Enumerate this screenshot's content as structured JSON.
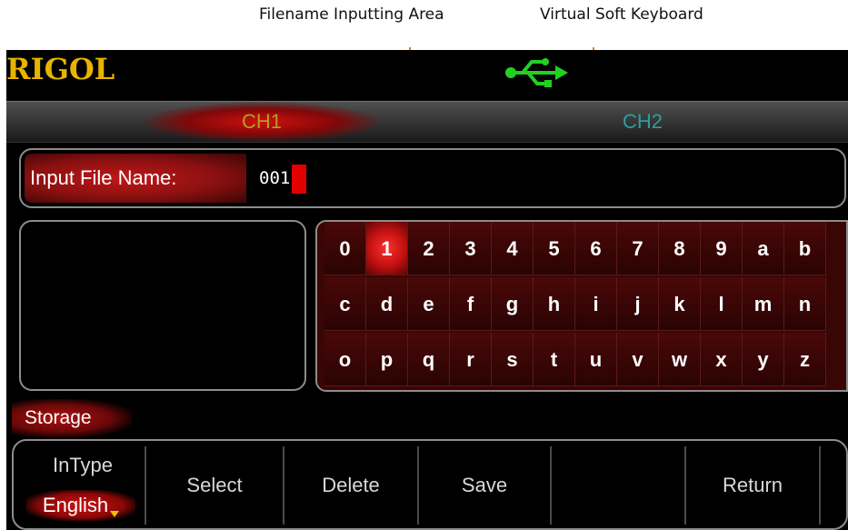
{
  "annotations": {
    "filename_area": "Filename Inputting Area",
    "soft_keyboard": "Virtual Soft Keyboard",
    "arrow_color": "#e07a1f"
  },
  "header": {
    "logo": "RIGOL",
    "usb_icon": "usb-icon",
    "logo_color": "#e8b400",
    "usb_color": "#22d022"
  },
  "tabs": [
    {
      "label": "CH1",
      "active": true
    },
    {
      "label": "CH2",
      "active": false
    }
  ],
  "filename": {
    "label": "Input File Name:",
    "value": "001"
  },
  "keyboard": {
    "selected_key": "1",
    "rows": [
      [
        "0",
        "1",
        "2",
        "3",
        "4",
        "5",
        "6",
        "7",
        "8",
        "9",
        "a",
        "b"
      ],
      [
        "c",
        "d",
        "e",
        "f",
        "g",
        "h",
        "i",
        "j",
        "k",
        "l",
        "m",
        "n"
      ],
      [
        "o",
        "p",
        "q",
        "r",
        "s",
        "t",
        "u",
        "v",
        "w",
        "x",
        "y",
        "z"
      ]
    ]
  },
  "menu_title": "Storage",
  "softkeys": {
    "intype_label": "InType",
    "intype_value": "English",
    "select": "Select",
    "delete": "Delete",
    "save": "Save",
    "empty": "",
    "return": "Return"
  }
}
